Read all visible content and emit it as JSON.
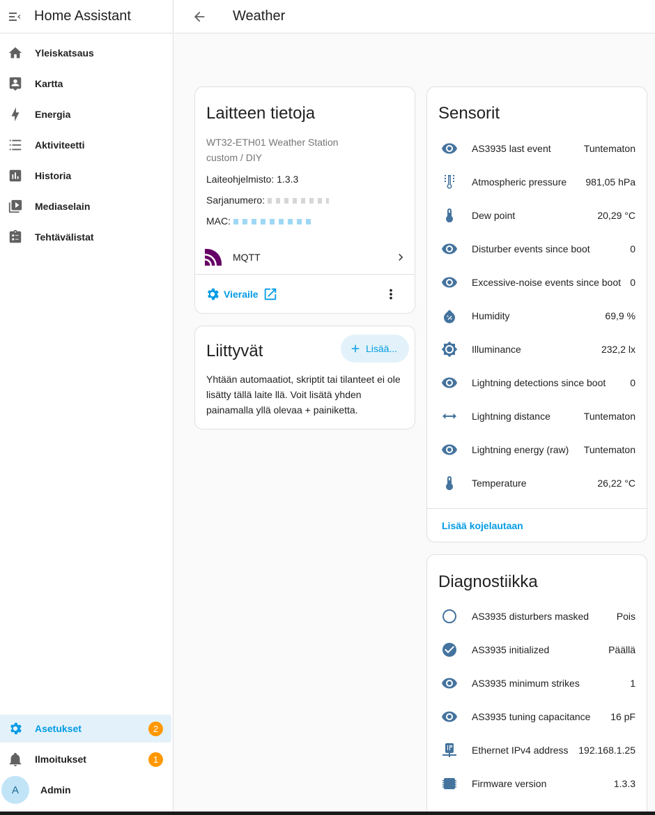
{
  "app": {
    "title": "Home Assistant"
  },
  "page": {
    "title": "Weather"
  },
  "sidebar": {
    "items": [
      {
        "label": "Yleiskatsaus",
        "icon": "home-icon"
      },
      {
        "label": "Kartta",
        "icon": "map-icon"
      },
      {
        "label": "Energia",
        "icon": "lightning-icon"
      },
      {
        "label": "Aktiviteetti",
        "icon": "list-icon"
      },
      {
        "label": "Historia",
        "icon": "chart-icon"
      },
      {
        "label": "Mediaselain",
        "icon": "media-icon"
      },
      {
        "label": "Tehtävälistat",
        "icon": "clipboard-icon"
      }
    ],
    "settings": {
      "label": "Asetukset",
      "badge": "2"
    },
    "notifications": {
      "label": "Ilmoitukset",
      "badge": "1"
    },
    "user": {
      "initial": "A",
      "name": "Admin"
    }
  },
  "device_info": {
    "title": "Laitteen tietoja",
    "model": "WT32-ETH01 Weather Station",
    "manufacturer": "custom / DIY",
    "firmware": "Laiteohjelmisto: 1.3.3",
    "serial_label": "Sarjanumero:",
    "mac_label": "MAC:",
    "integration": "MQTT",
    "visit_label": "Vieraile"
  },
  "related": {
    "title": "Liittyvät",
    "add_label": "Lisää...",
    "text": "Yhtään automaatiot, skriptit tai tilanteet ei ole lisätty tällä laite llä. Voit lisätä yhden painamalla yllä olevaa + painiketta."
  },
  "sensors": {
    "title": "Sensorit",
    "items": [
      {
        "name": "AS3935 last event",
        "value": "Tuntematon",
        "icon": "eye-icon"
      },
      {
        "name": "Atmospheric pressure",
        "value": "981,05 hPa",
        "icon": "gauge-icon"
      },
      {
        "name": "Dew point",
        "value": "20,29 °C",
        "icon": "thermometer-icon"
      },
      {
        "name": "Disturber events since boot",
        "value": "0",
        "icon": "eye-icon"
      },
      {
        "name": "Excessive-noise events since boot",
        "value": "0",
        "icon": "eye-icon"
      },
      {
        "name": "Humidity",
        "value": "69,9 %",
        "icon": "water-percent-icon"
      },
      {
        "name": "Illuminance",
        "value": "232,2 lx",
        "icon": "brightness-icon"
      },
      {
        "name": "Lightning detections since boot",
        "value": "0",
        "icon": "eye-icon"
      },
      {
        "name": "Lightning distance",
        "value": "Tuntematon",
        "icon": "arrow-left-right-icon"
      },
      {
        "name": "Lightning energy (raw)",
        "value": "Tuntematon",
        "icon": "eye-icon"
      },
      {
        "name": "Temperature",
        "value": "26,22 °C",
        "icon": "thermometer-icon"
      }
    ],
    "add_to_dashboard": "Lisää kojelautaan"
  },
  "diagnostics": {
    "title": "Diagnostiikka",
    "items": [
      {
        "name": "AS3935 disturbers masked",
        "value": "Pois",
        "icon": "circle-outline-icon"
      },
      {
        "name": "AS3935 initialized",
        "value": "Päällä",
        "icon": "check-circle-icon"
      },
      {
        "name": "AS3935 minimum strikes",
        "value": "1",
        "icon": "eye-icon"
      },
      {
        "name": "AS3935 tuning capacitance",
        "value": "16 pF",
        "icon": "eye-icon"
      },
      {
        "name": "Ethernet IPv4 address",
        "value": "192.168.1.25",
        "icon": "ip-network-icon"
      },
      {
        "name": "Firmware version",
        "value": "1.3.3",
        "icon": "chip-icon"
      }
    ]
  },
  "colors": {
    "accent": "#039be5",
    "icon": "#44739e",
    "badge": "#ff9800",
    "mqtt": "#660066"
  }
}
